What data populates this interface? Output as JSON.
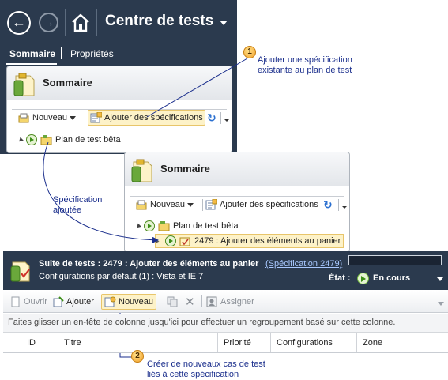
{
  "header": {
    "title": "Centre de tests",
    "tabs": [
      {
        "label": "Sommaire",
        "active": true
      },
      {
        "label": "Propriétés",
        "active": false
      }
    ]
  },
  "summary_panel_1": {
    "title": "Sommaire",
    "toolbar": {
      "new_label": "Nouveau",
      "add_specs_label": "Ajouter des spécifications"
    },
    "tree": [
      {
        "label": "Plan de test bêta"
      }
    ]
  },
  "summary_panel_2": {
    "title": "Sommaire",
    "toolbar": {
      "new_label": "Nouveau",
      "add_specs_label": "Ajouter des spécifications"
    },
    "tree": [
      {
        "label": "Plan de test bêta"
      },
      {
        "label": "2479 : Ajouter des éléments au panier"
      }
    ]
  },
  "callouts": {
    "c1": {
      "number": "1",
      "lines": [
        "Ajouter une spécification",
        "existante au plan de test"
      ]
    },
    "spec_added": {
      "lines": [
        "Spécification",
        "ajoutée"
      ]
    },
    "c2": {
      "number": "2",
      "lines": [
        "Créer de nouveaux cas de test",
        "liés à cette spécification"
      ]
    }
  },
  "suite": {
    "title": "Suite de tests :  2479 : Ajouter des éléments au panier",
    "spec_link": "(Spécification 2479)",
    "configs": "Configurations par défaut (1) : Vista et IE 7",
    "state_label": "État :",
    "state_value": "En cours",
    "toolbar": {
      "open": "Ouvrir",
      "add": "Ajouter",
      "new": "Nouveau",
      "assign": "Assigner"
    },
    "group_hint": "Faites glisser un en-tête de colonne jusqu'ici pour effectuer un regroupement basé sur cette colonne.",
    "columns": [
      "ID",
      "Titre",
      "Priorité",
      "Configurations",
      "Zone"
    ]
  },
  "colors": {
    "header_bg": "#2b3a4e",
    "highlight_bg": "#fdf2c8",
    "callout_text": "#1a2e8c",
    "callout_line": "#1a2e8c"
  },
  "icons": [
    "back-arrow-icon",
    "forward-arrow-icon",
    "home-icon",
    "test-plan-icon",
    "new-icon",
    "add-specs-icon",
    "refresh-icon",
    "play-icon",
    "open-icon",
    "add-icon",
    "copy-icon",
    "delete-icon",
    "assign-icon"
  ]
}
